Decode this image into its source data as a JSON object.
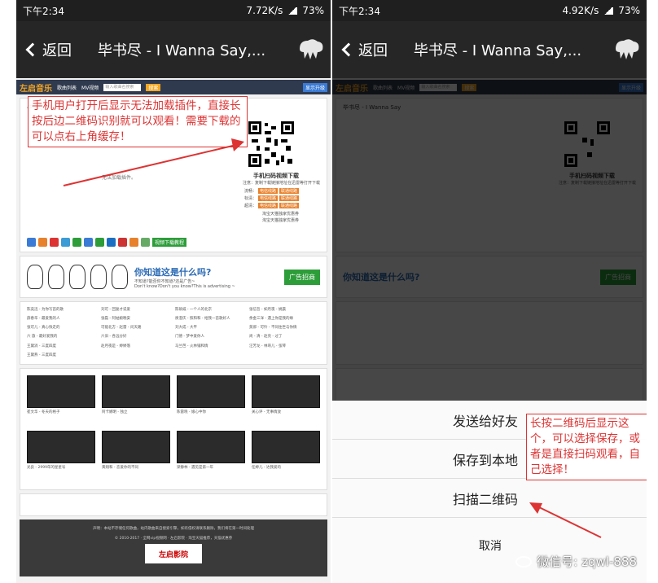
{
  "left": {
    "status": {
      "time": "下午2:34",
      "speed": "7.72K/s",
      "battery": "73%"
    },
    "nav": {
      "back": "返回",
      "title": "毕书尽 - I Wanna Say,..."
    }
  },
  "right": {
    "status": {
      "time": "下午2:34",
      "speed": "4.92K/s",
      "battery": "73%"
    },
    "nav": {
      "back": "返回",
      "title": "毕书尽 - I Wanna Say,..."
    }
  },
  "site": {
    "logo": "左启音乐",
    "nav_songs": "歌曲列表",
    "nav_mv": "MV视频",
    "search_placeholder": "输入歌曲名搜索",
    "search_btn": "搜索",
    "right_btn": "显示升级",
    "song_title": "毕书尽 - I Wanna Say",
    "no_plugin": "无法加载插件。",
    "qr_title": "手机扫码视频下载",
    "qr_desc": "注意：复制下载链接地址在迅雷等打开下载",
    "dl_rows": [
      {
        "label": "流畅：",
        "a": "电信线路",
        "b": "联通线路"
      },
      {
        "label": "标清：",
        "a": "电信线路",
        "b": "联通线路"
      },
      {
        "label": "超清：",
        "a": "电信线路",
        "b": "联通线路"
      }
    ],
    "promo1": "淘宝天猫独家优惠券",
    "promo2": "淘宝天猫独家优惠券",
    "dl_button": "视频下载教程",
    "ad_title": "你知道这是什么吗?",
    "ad_sub": "不知道?能否你不知道?还是广告~",
    "ad_sub2": "Don't know?Don't you know?This is advertising ~",
    "ad_btn": "广告招商",
    "list": [
      "陈奕迅 - 为你写首的歌",
      "刘可 - 回复才说爱",
      "陈硕威 - 一个人的北京",
      "张信哲 - 如月夜 - 姚晨",
      "薛春华 - 最爱我的人",
      "张磊 - 阿姑娘晚安",
      "庾澄庆 - 照和和 - 给我一首歌好人",
      "余金三洋 - 遇上你是我的缘",
      "张可儿 - 真心快走的",
      "可能北方 - 赵雷 - 问天路",
      "刘大成 - 大平",
      "莫邪 - 可怜 - 不同往世与你情",
      "六 旅 - 最好爱我的",
      "六旧 - 各远分好",
      "门德 - 梦中爱你人",
      "尚 - 清 - 赵亮 - 过了",
      "王黛涓 - 三度四度",
      "赵月夜是 - 婷婷落",
      "马兰芭 - 火林铺和情",
      "汪芳龙 - 林哥儿 - 弦琴",
      "王黛燕 - 三度四度"
    ],
    "thumbs": [
      "崔文华 - 冬天的格子",
      "阿卡娜明 - 独立",
      "陈雷晓 - 娘心中你",
      "关心评 - 无事情放",
      "光良 - 2999年的星星号",
      "黄翔和 - 恋爱你的不同",
      "梁静林 - 遇见是第一年",
      "任婷儿 - 达我爱的"
    ],
    "footer1": "声明：本站不存储任何歌曲，站内歌曲来自搜索引擎，如有侵权请联系删除，我们将在第一时间处理",
    "footer2": "© 2010-2017 · 全网vip视频网 · 左启影院 · 淘宝天猫推荐，天猫优惠券",
    "footer_logo": "左启影院"
  },
  "menu": {
    "send": "发送给好友",
    "save": "保存到本地",
    "scan": "扫描二维码",
    "cancel": "取消"
  },
  "annotations": {
    "left": "手机用户打开后显示无法加载插件，直接长按后边二维码识别就可以观看！需要下载的可以点右上角缓存！",
    "right": "长按二维码后显示这个，可以选择保存，或者是直接扫码观看，自己选择！"
  },
  "watermark": "微信号: zqwl-888",
  "colors": {
    "annotation": "#d33333",
    "accent": "#f5a623",
    "green": "#2d9d3a"
  }
}
